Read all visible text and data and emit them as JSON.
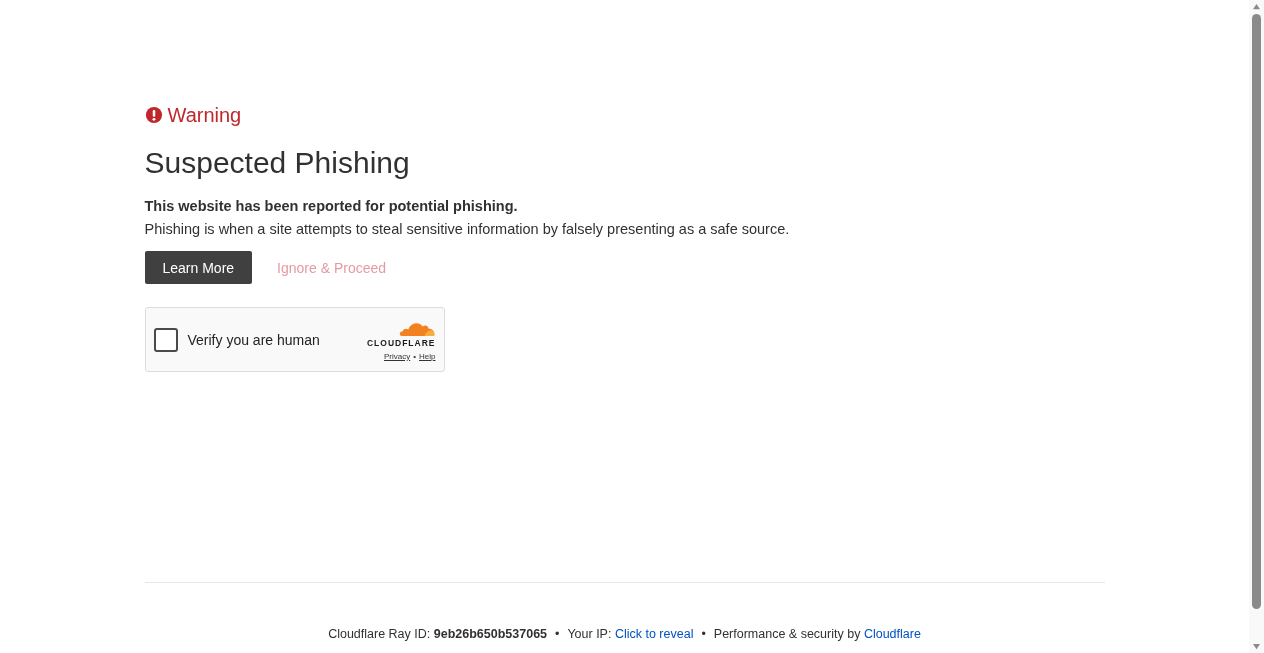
{
  "warning": {
    "label": "Warning"
  },
  "title": "Suspected Phishing",
  "lead": "This website has been reported for potential phishing.",
  "description": "Phishing is when a site attempts to steal sensitive information by falsely presenting as a safe source.",
  "buttons": [
    {
      "label": "Learn More",
      "kind": "primary"
    },
    {
      "label": "Ignore & Proceed",
      "kind": "link"
    }
  ],
  "captcha": {
    "label": "Verify you are human",
    "checked": false,
    "brand": "CLOUDFLARE",
    "links": [
      "Privacy",
      "Help"
    ],
    "separator": "•"
  },
  "footer": [
    {
      "kind": "text",
      "text": "Cloudflare Ray ID: "
    },
    {
      "kind": "bold",
      "text": "9eb26b650b537065"
    },
    {
      "kind": "separator",
      "text": "•"
    },
    {
      "kind": "text",
      "text": "Your IP: "
    },
    {
      "kind": "link",
      "text": "Click to reveal"
    },
    {
      "kind": "separator",
      "text": "•"
    },
    {
      "kind": "text",
      "text": "Performance & security by "
    },
    {
      "kind": "link",
      "text": "Cloudflare"
    }
  ]
}
